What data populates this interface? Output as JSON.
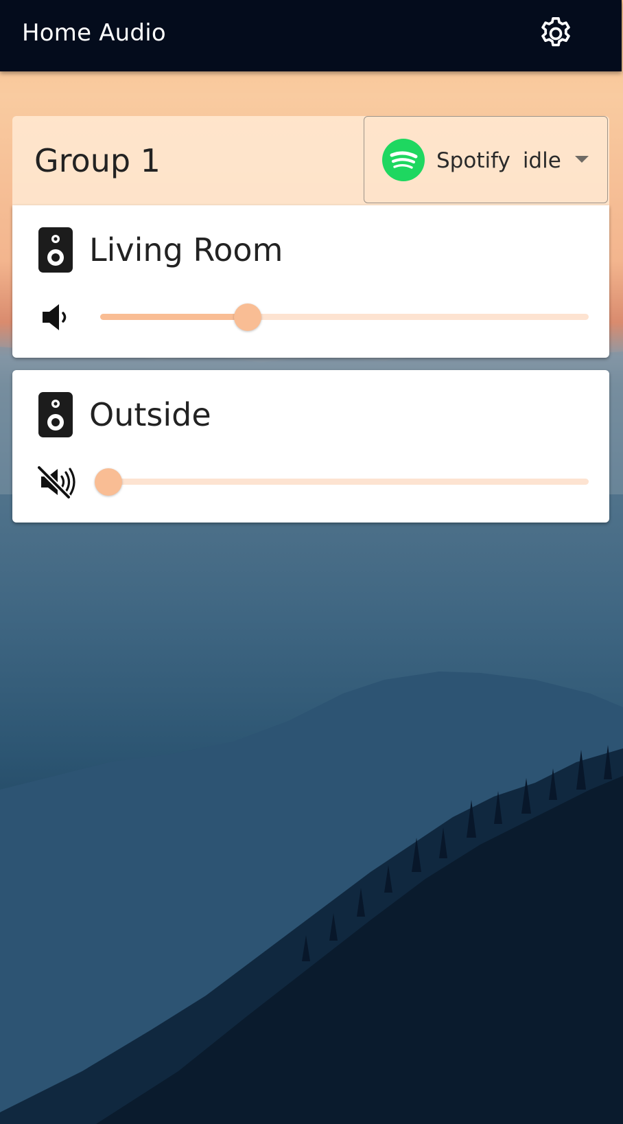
{
  "header": {
    "title": "Home Audio",
    "settings_icon": "gear-icon"
  },
  "group": {
    "title": "Group 1",
    "source": {
      "name": "Spotify",
      "status": "idle",
      "icon": "spotify-logo",
      "brand_color": "#1ed760"
    }
  },
  "zones": [
    {
      "name": "Living Room",
      "icon": "speaker-icon",
      "volume_icon": "volume-on-icon",
      "muted": false,
      "volume_fraction": 0.29
    },
    {
      "name": "Outside",
      "icon": "speaker-icon",
      "volume_icon": "volume-muted-icon",
      "muted": true,
      "volume_fraction": 0.0
    }
  ],
  "colors": {
    "accent": "#f9bd94",
    "rail": "#fde3d1",
    "appbar": "#040c1c"
  }
}
